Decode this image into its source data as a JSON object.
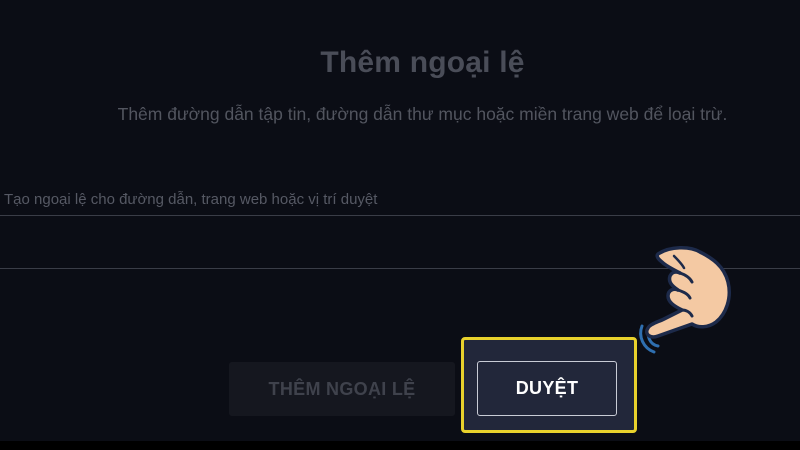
{
  "dialog": {
    "title": "Thêm ngoại lệ",
    "subtitle": "Thêm đường dẫn tập tin, đường dẫn thư mục hoặc miền trang web để loại trừ.",
    "field": {
      "label": "Tạo ngoại lệ cho đường dẫn, trang web hoặc vị trí duyệt",
      "value": ""
    },
    "buttons": {
      "add_exception": "THÊM NGOẠI LỆ",
      "browse": "DUYỆT"
    }
  },
  "annotation": {
    "highlight_color": "#e8d12c",
    "pointer_icon": "pointing-hand-icon",
    "hand_color": "#f4c9a3"
  },
  "colors": {
    "background": "#0b0d15",
    "browse_button_bg": "#22273a"
  }
}
